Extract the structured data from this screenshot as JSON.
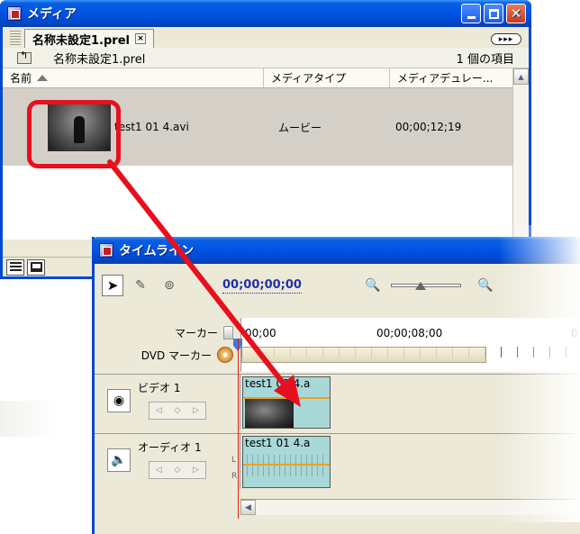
{
  "media_window": {
    "title": "メディア",
    "tab_label": "名称未設定1.prel",
    "tab_close": "×",
    "menu_glyph": "▸▸▸",
    "project_name": "名称未設定1.prel",
    "item_count": "1 個の項目",
    "columns": [
      "名前",
      "メディアタイプ",
      "メディアデュレー..."
    ],
    "clip": {
      "name": "test1 01 4.avi",
      "type": "ムービー",
      "duration": "00;00;12;19"
    }
  },
  "timeline_window": {
    "title": "タイムライン",
    "timecode": "00;00;00;00",
    "marker_label": "マーカー",
    "dvd_marker_label": "DVD マーカー",
    "ruler_labels": [
      "00;00",
      "00;00;08;00",
      "0"
    ],
    "video_track": {
      "name": "ビデオ 1",
      "clip_name": "test1 01 4.a"
    },
    "audio_track": {
      "name": "オーディオ 1",
      "clip_name": "test1 01 4.a",
      "channel_l": "L",
      "channel_r": "R"
    }
  },
  "icons": {
    "keyframe_prev": "◁",
    "keyframe_add": "◇",
    "keyframe_next": "▷",
    "zoom_out": "🔍",
    "zoom_in": "🔍"
  },
  "colors": {
    "xp_title_blue": "#0055e5",
    "highlight_red": "#e8101e",
    "clip_teal": "#a8d8d8",
    "timecode_blue": "#2030a8"
  }
}
